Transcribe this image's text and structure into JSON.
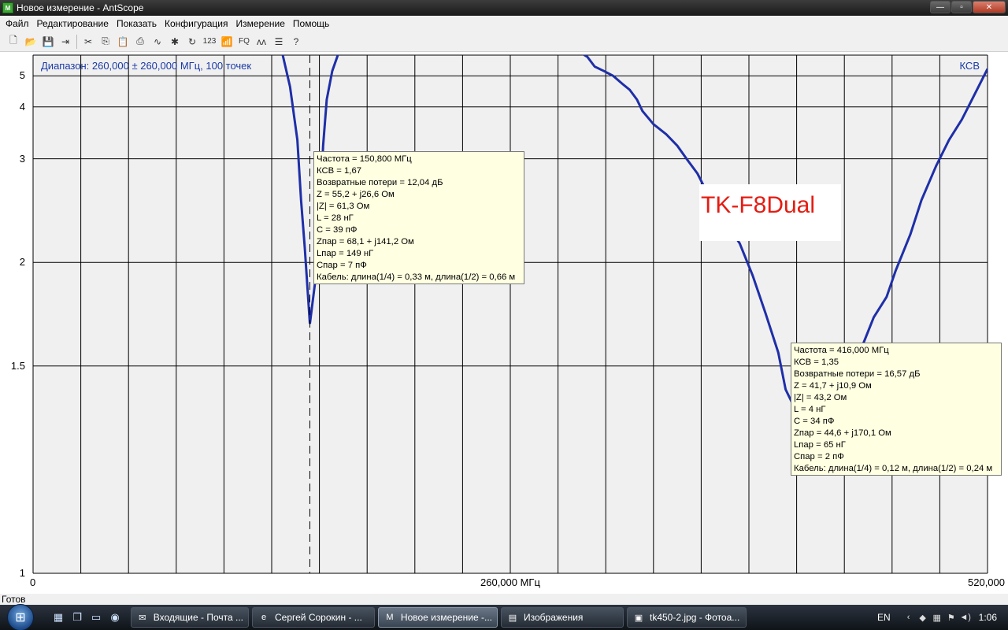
{
  "window": {
    "title": "Новое измерение - AntScope",
    "app_icon_text": "M",
    "controls": {
      "minimize": "—",
      "maximize": "▫",
      "close": "✕"
    }
  },
  "menu": [
    "Файл",
    "Редактирование",
    "Показать",
    "Конфигурация",
    "Измерение",
    "Помощь"
  ],
  "toolbar": [
    {
      "icon": "new-file-icon",
      "glyph": "🗋"
    },
    {
      "icon": "open-folder-icon",
      "glyph": "📂"
    },
    {
      "icon": "save-icon",
      "glyph": "💾"
    },
    {
      "icon": "export-icon",
      "glyph": "⇥"
    },
    {
      "sep": true
    },
    {
      "icon": "cut-icon",
      "glyph": "✂"
    },
    {
      "icon": "copy-icon",
      "glyph": "⎘"
    },
    {
      "icon": "paste-icon",
      "glyph": "📋"
    },
    {
      "icon": "print-icon",
      "glyph": "⎙"
    },
    {
      "icon": "chart-icon",
      "glyph": "∿"
    },
    {
      "icon": "settings-icon",
      "glyph": "✱"
    },
    {
      "icon": "refresh-icon",
      "glyph": "↻"
    },
    {
      "icon": "numeric-icon",
      "glyph": "123"
    },
    {
      "icon": "antenna-icon",
      "glyph": "📶"
    },
    {
      "icon": "fq-icon",
      "glyph": "FQ"
    },
    {
      "icon": "markers-icon",
      "glyph": "ʌʌ"
    },
    {
      "icon": "notes-icon",
      "glyph": "☰"
    },
    {
      "icon": "help-icon",
      "glyph": "?"
    }
  ],
  "chart": {
    "range_label": "Диапазон: 260,000 ± 260,000 МГц, 100 точек",
    "mode_label": "КСВ",
    "model_label": "TK-F8Dual",
    "colors": {
      "curve": "#1f2fa8",
      "grid": "#000000",
      "plot_bg": "#f0f0f0",
      "tooltip_bg": "#ffffe1"
    }
  },
  "chart_data": {
    "type": "line",
    "title": "",
    "xlabel": "",
    "ylabel": "КСВ",
    "xlim": [
      0,
      520
    ],
    "ylim": [
      1,
      6
    ],
    "y_scale": "swr",
    "x_tick_labels": [
      {
        "x": 0,
        "label": "0"
      },
      {
        "x": 260,
        "label": "260,000 МГц"
      },
      {
        "x": 520,
        "label": "520,000"
      }
    ],
    "y_ticks": [
      1,
      1.5,
      2,
      3,
      4,
      5
    ],
    "y_tick_labels": [
      "1",
      "1.5",
      "2",
      "3",
      "4",
      "5"
    ],
    "series": [
      {
        "x": [
          0,
          135,
          140,
          144,
          146,
          148,
          150.8,
          155,
          158,
          160,
          163,
          167,
          172,
          175,
          180,
          200,
          220,
          250,
          290,
          296,
          302,
          306,
          311,
          316,
          321,
          325,
          329,
          332,
          338,
          345,
          351,
          356,
          362,
          368,
          374,
          378,
          385,
          392,
          399,
          406,
          410,
          416,
          422,
          426,
          432,
          438,
          445,
          452,
          458,
          465,
          470,
          478,
          484,
          492,
          499,
          506,
          512,
          520
        ],
        "y": [
          6.5,
          6.5,
          4.6,
          3.3,
          2.5,
          2.1,
          1.67,
          2.0,
          3.2,
          4.2,
          5.2,
          6.3,
          6.8,
          6.5,
          6.5,
          6.5,
          6.5,
          6.5,
          6.5,
          6.3,
          5.9,
          5.4,
          5.2,
          5.0,
          4.7,
          4.5,
          4.2,
          3.9,
          3.6,
          3.4,
          3.2,
          3.0,
          2.8,
          2.55,
          2.4,
          2.28,
          2.13,
          1.92,
          1.72,
          1.55,
          1.42,
          1.35,
          1.34,
          1.36,
          1.4,
          1.43,
          1.5,
          1.58,
          1.7,
          1.8,
          1.95,
          2.2,
          2.5,
          2.9,
          3.3,
          3.7,
          4.25,
          5.3
        ]
      }
    ],
    "marker_x": 150.8
  },
  "tooltips": [
    {
      "lines": [
        "Частота = 150,800 МГц",
        "КСВ = 1,67",
        "Возвратные потери = 12,04 дБ",
        "Z = 55,2 + j26,6 Ом",
        "|Z| = 61,3 Ом",
        "L = 28 нГ",
        "C = 39 пФ",
        "Zпар = 68,1 + j141,2 Ом",
        "Lпар = 149 нГ",
        "Cпар = 7 пФ",
        "Кабель: длина(1/4) = 0,33 м, длина(1/2) = 0,66 м"
      ]
    },
    {
      "lines": [
        "Частота = 416,000 МГц",
        "КСВ = 1,35",
        "Возвратные потери = 16,57 дБ",
        "Z = 41,7 + j10,9 Ом",
        "|Z| = 43,2 Ом",
        "L = 4 нГ",
        "C = 34 пФ",
        "Zпар = 44,6 + j170,1 Ом",
        "Lпар = 65 нГ",
        "Cпар = 2 пФ",
        "Кабель: длина(1/4) = 0,12 м, длина(1/2) = 0,24 м"
      ]
    }
  ],
  "status": {
    "text": "Готов"
  },
  "taskbar": {
    "quicklaunch": [
      {
        "icon": "show-desktop-icon",
        "glyph": "▦"
      },
      {
        "icon": "switch-windows-icon",
        "glyph": "❐"
      },
      {
        "icon": "computer-icon",
        "glyph": "▭"
      },
      {
        "icon": "chrome-icon",
        "glyph": "◉"
      }
    ],
    "tasks": [
      {
        "label": "Входящие - Почта ...",
        "icon": "mail-icon",
        "glyph": "✉",
        "active": false
      },
      {
        "label": "Сергей Сорокин - ...",
        "icon": "ie-icon",
        "glyph": "e",
        "active": false
      },
      {
        "label": "Новое измерение -...",
        "icon": "antscope-icon",
        "glyph": "M",
        "active": true
      },
      {
        "label": "Изображения",
        "icon": "folder-icon",
        "glyph": "▤",
        "active": false
      },
      {
        "label": "tk450-2.jpg - Фотоа...",
        "icon": "photo-icon",
        "glyph": "▣",
        "active": false
      }
    ],
    "tray": {
      "language": "EN",
      "clock": "1:06",
      "icons": [
        "chevron-left-icon",
        "antivirus-icon",
        "network-icon",
        "flag-icon",
        "speaker-icon"
      ]
    }
  }
}
